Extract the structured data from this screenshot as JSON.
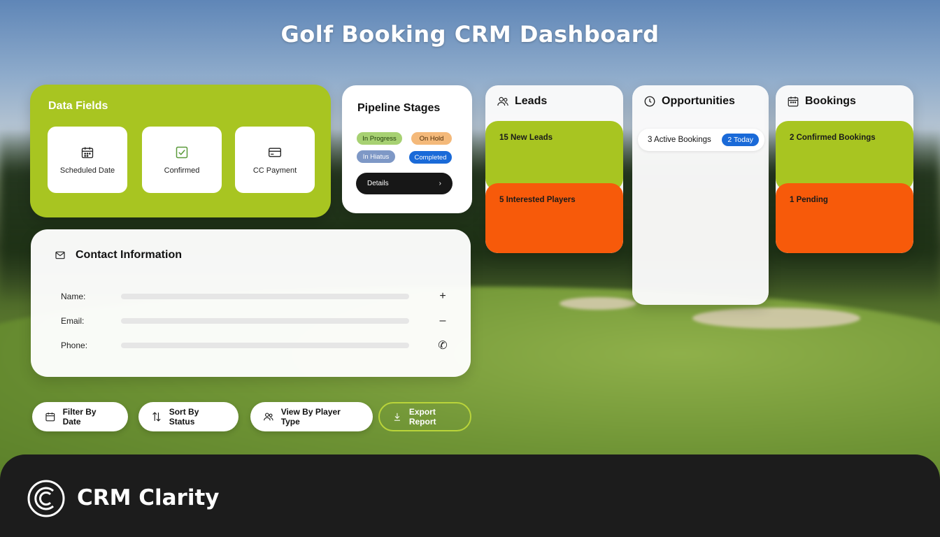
{
  "title": "Golf Booking CRM Dashboard",
  "data_fields": {
    "heading": "Data Fields",
    "tiles": [
      {
        "label": "Scheduled Date",
        "icon": "calendar-icon"
      },
      {
        "label": "Confirmed",
        "icon": "checkbox-icon"
      },
      {
        "label": "CC Payment",
        "icon": "credit-card-icon"
      }
    ]
  },
  "pipeline": {
    "heading": "Pipeline Stages",
    "stages": [
      "In Progress",
      "On Hold",
      "In Hiatus",
      "Completed"
    ],
    "details_label": "Details"
  },
  "contact": {
    "heading": "Contact Information",
    "fields": [
      {
        "label": "Name:",
        "action": "+"
      },
      {
        "label": "Email:",
        "action": "–"
      },
      {
        "label": "Phone:",
        "action": "✆"
      }
    ]
  },
  "leads": {
    "heading": "Leads",
    "cards": [
      "15 New Leads",
      "5 Interested Players"
    ]
  },
  "opportunities": {
    "heading": "Opportunities",
    "item": "3 Active Bookings",
    "badge": "2 Today"
  },
  "bookings": {
    "heading": "Bookings",
    "cards": [
      "2 Confirmed Bookings",
      "1 Pending"
    ]
  },
  "toolbar": {
    "filter_label": "Filter By Date",
    "sort_label": "Sort By Status",
    "view_label": "View By Player Type",
    "export_label": "Export Report"
  },
  "footer": {
    "brand": "CRM Clarity"
  },
  "colors": {
    "accent_green": "#a8c521",
    "accent_orange": "#f75a0a",
    "accent_blue": "#1a6ad8",
    "footer_bg": "#1c1c1c"
  }
}
